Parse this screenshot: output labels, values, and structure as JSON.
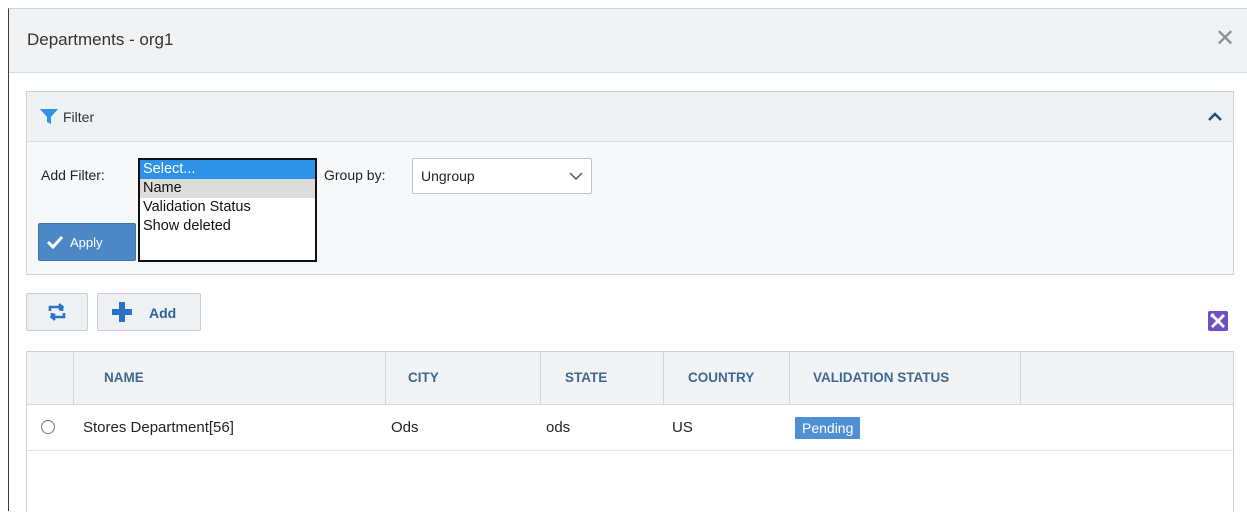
{
  "window": {
    "title": "Departments - org1",
    "close_icon": "close-icon"
  },
  "filter": {
    "title": "Filter",
    "add_filter_label": "Add Filter:",
    "add_filter_options": [
      "Select...",
      "Name",
      "Validation Status",
      "Show deleted"
    ],
    "group_by_label": "Group by:",
    "group_by_value": "Ungroup",
    "apply_label": "Apply"
  },
  "toolbar": {
    "add_label": "Add"
  },
  "table": {
    "columns": [
      "NAME",
      "CITY",
      "STATE",
      "COUNTRY",
      "VALIDATION STATUS"
    ],
    "rows": [
      {
        "name": "Stores Department[56]",
        "city": "Ods",
        "state": "ods",
        "country": "US",
        "validation_status": "Pending"
      }
    ]
  },
  "colors": {
    "accent": "#2e93e8",
    "apply_button": "#4d88c6",
    "status_badge": "#4f8fd4",
    "header_text": "#3b6a93",
    "settings_button": "#6f4fc4"
  }
}
